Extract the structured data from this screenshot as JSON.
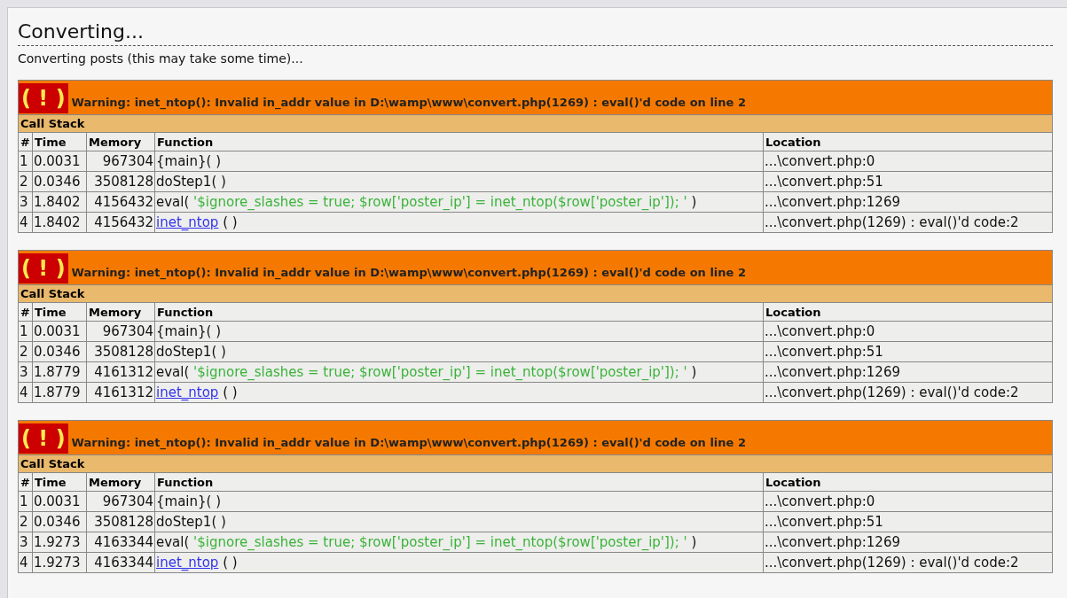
{
  "title": "Converting...",
  "subtitle": "Converting posts (this may take some time)...",
  "errors": [
    {
      "badge": "( ! )",
      "message": "Warning: inet_ntop(): Invalid in_addr value in D:\\wamp\\www\\convert.php(1269) : eval()'d code on line 2",
      "section": "Call Stack",
      "columns": [
        "#",
        "Time",
        "Memory",
        "Function",
        "Location"
      ],
      "rows": [
        {
          "index": "1",
          "time": "0.0031",
          "memory": "967304",
          "function": {
            "kind": "plain",
            "text": "{main}( )"
          },
          "location": "...\\convert.php:0"
        },
        {
          "index": "2",
          "time": "0.0346",
          "memory": "3508128",
          "function": {
            "kind": "plain",
            "text": "doStep1( )"
          },
          "location": "...\\convert.php:51"
        },
        {
          "index": "3",
          "time": "1.8402",
          "memory": "4156432",
          "function": {
            "kind": "code",
            "text": "eval(",
            "code": "'$ignore_slashes = true; $row['poster_ip'] = inet_ntop($row['poster_ip']); '",
            "close": ")"
          },
          "location": "...\\convert.php:1269"
        },
        {
          "index": "4",
          "time": "1.8402",
          "memory": "4156432",
          "function": {
            "kind": "link",
            "text": "inet_ntop",
            "close": "( )"
          },
          "location": "...\\convert.php(1269) : eval()'d code:2"
        }
      ]
    },
    {
      "badge": "( ! )",
      "message": "Warning: inet_ntop(): Invalid in_addr value in D:\\wamp\\www\\convert.php(1269) : eval()'d code on line 2",
      "section": "Call Stack",
      "columns": [
        "#",
        "Time",
        "Memory",
        "Function",
        "Location"
      ],
      "rows": [
        {
          "index": "1",
          "time": "0.0031",
          "memory": "967304",
          "function": {
            "kind": "plain",
            "text": "{main}( )"
          },
          "location": "...\\convert.php:0"
        },
        {
          "index": "2",
          "time": "0.0346",
          "memory": "3508128",
          "function": {
            "kind": "plain",
            "text": "doStep1( )"
          },
          "location": "...\\convert.php:51"
        },
        {
          "index": "3",
          "time": "1.8779",
          "memory": "4161312",
          "function": {
            "kind": "code",
            "text": "eval(",
            "code": "'$ignore_slashes = true; $row['poster_ip'] = inet_ntop($row['poster_ip']); '",
            "close": ")"
          },
          "location": "...\\convert.php:1269"
        },
        {
          "index": "4",
          "time": "1.8779",
          "memory": "4161312",
          "function": {
            "kind": "link",
            "text": "inet_ntop",
            "close": "( )"
          },
          "location": "...\\convert.php(1269) : eval()'d code:2"
        }
      ]
    },
    {
      "badge": "( ! )",
      "message": "Warning: inet_ntop(): Invalid in_addr value in D:\\wamp\\www\\convert.php(1269) : eval()'d code on line 2",
      "section": "Call Stack",
      "columns": [
        "#",
        "Time",
        "Memory",
        "Function",
        "Location"
      ],
      "rows": [
        {
          "index": "1",
          "time": "0.0031",
          "memory": "967304",
          "function": {
            "kind": "plain",
            "text": "{main}( )"
          },
          "location": "...\\convert.php:0"
        },
        {
          "index": "2",
          "time": "0.0346",
          "memory": "3508128",
          "function": {
            "kind": "plain",
            "text": "doStep1( )"
          },
          "location": "...\\convert.php:51"
        },
        {
          "index": "3",
          "time": "1.9273",
          "memory": "4163344",
          "function": {
            "kind": "code",
            "text": "eval(",
            "code": "'$ignore_slashes = true; $row['poster_ip'] = inet_ntop($row['poster_ip']); '",
            "close": ")"
          },
          "location": "...\\convert.php:1269"
        },
        {
          "index": "4",
          "time": "1.9273",
          "memory": "4163344",
          "function": {
            "kind": "link",
            "text": "inet_ntop",
            "close": "( )"
          },
          "location": "...\\convert.php(1269) : eval()'d code:2"
        }
      ]
    }
  ]
}
